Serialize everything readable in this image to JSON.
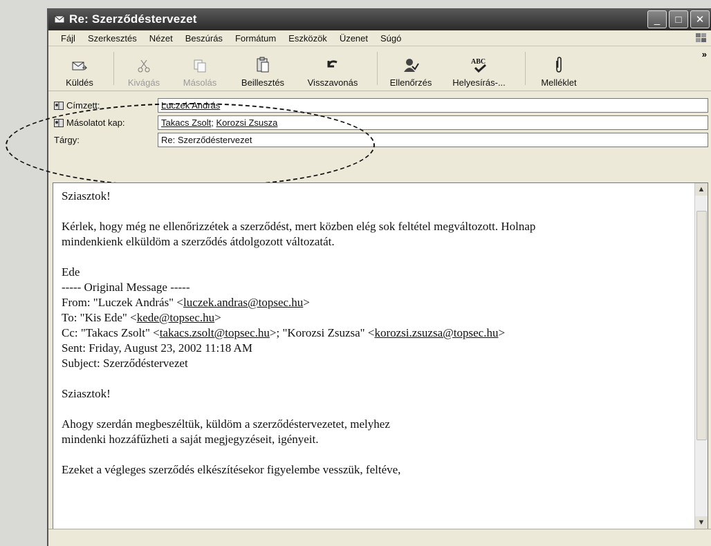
{
  "window": {
    "title": "Re: Szerződéstervezet"
  },
  "menu": [
    "Fájl",
    "Szerkesztés",
    "Nézet",
    "Beszúrás",
    "Formátum",
    "Eszközök",
    "Üzenet",
    "Súgó"
  ],
  "toolbar": {
    "send": "Küldés",
    "cut": "Kivágás",
    "copy": "Másolás",
    "paste": "Beillesztés",
    "undo": "Visszavonás",
    "check": "Ellenőrzés",
    "spelling": "Helyesírás-...",
    "attach": "Melléklet",
    "more": "»"
  },
  "header": {
    "to_label": "Címzett:",
    "to_value": "Luczek András",
    "cc_label": "Másolatot kap:",
    "cc_value1": "Takacs Zsolt",
    "cc_sep": ";",
    "cc_value2": "Korozsi Zsusza",
    "subject_label": "Tárgy:",
    "subject_value": "Re: Szerződéstervezet"
  },
  "body": {
    "l1": "Sziasztok!",
    "l2": "Kérlek, hogy még ne ellenőrizzétek a szerződést, mert közben elég sok feltétel megváltozott. Holnap",
    "l3": "mindenkienk elküldöm a szerződés átdolgozott változatát.",
    "l4": "Ede",
    "l5": "----- Original Message -----",
    "from_pre": "From: \"Luczek András\" <",
    "from_email": "luczek.andras@topsec.hu",
    "from_post": ">",
    "to_pre": "To: \"Kis Ede\" <",
    "to_email": "kede@topsec.hu",
    "to_post": ">",
    "cc_pre": "Cc: \"Takacs Zsolt\" <",
    "cc_email1": "takacs.zsolt@topsec.hu",
    "cc_mid": ">; \"Korozsi Zsuzsa\" <",
    "cc_email2": "korozsi.zsuzsa@topsec.hu",
    "cc_post": ">",
    "sent": "Sent: Friday, August 23, 2002 11:18 AM",
    "subject": "Subject: Szerződéstervezet",
    "l6": "Sziasztok!",
    "l7": "Ahogy szerdán megbeszéltük, küldöm a szerződéstervezetet, melyhez",
    "l8": "mindenki hozzáfűzheti a saját megjegyzéseit, igényeit.",
    "l9": "Ezeket a végleges szerződés elkészítésekor figyelembe vesszük, feltéve,"
  }
}
